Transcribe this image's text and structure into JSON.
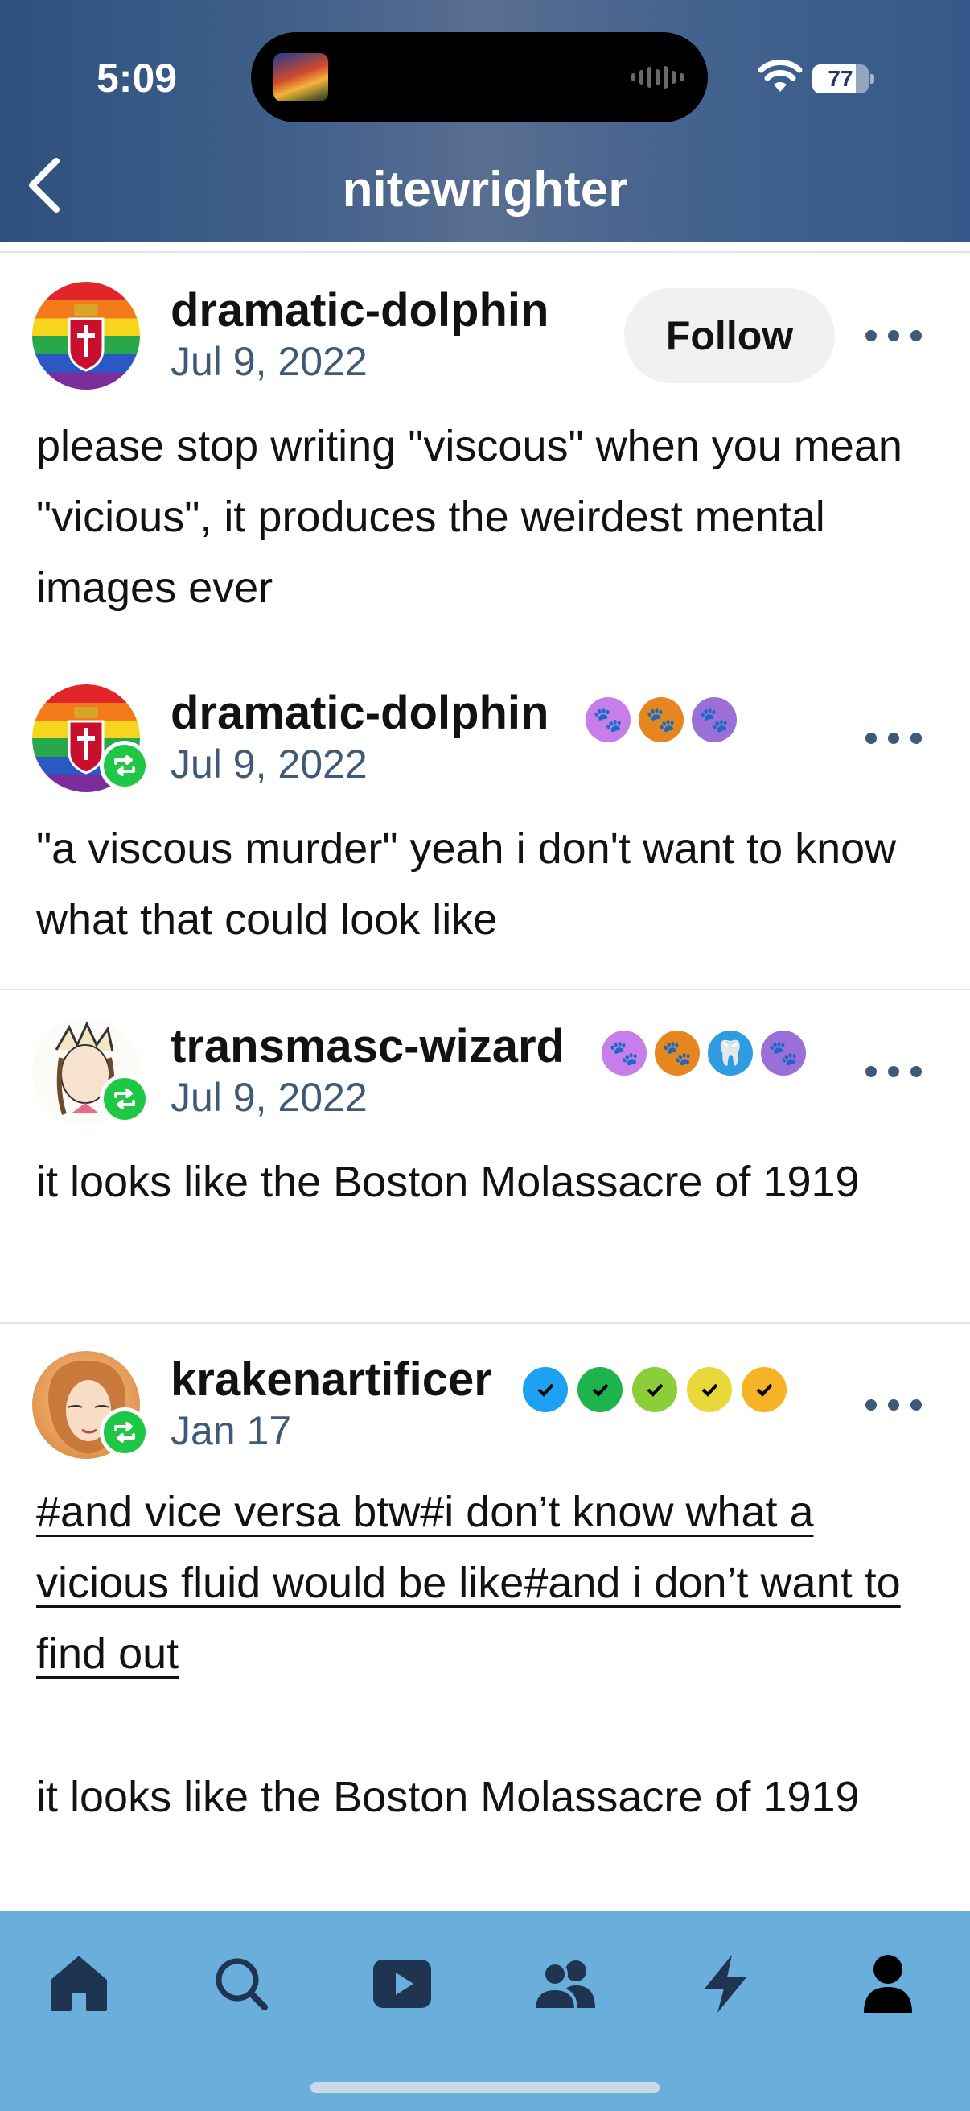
{
  "status_bar": {
    "time": "5:09",
    "battery_level": "77",
    "battery_fraction": 0.77,
    "icons": [
      "album-art-icon",
      "audio-waveform-icon",
      "wifi-icon",
      "battery-icon"
    ]
  },
  "header": {
    "title": "nitewrighter",
    "back_icon": "chevron-left-icon",
    "background_color": "#3d5c88"
  },
  "posts": [
    {
      "username": "dramatic-dolphin",
      "date": "Jul 9, 2022",
      "follow_label": "Follow",
      "text": "please stop writing \"viscous\" when you mean \"vicious\", it produces the weirdest mental images ever"
    },
    {
      "username": "dramatic-dolphin",
      "date": "Jul 9, 2022",
      "badges": [
        "pink-paw-badge",
        "orange-paw-badge",
        "black-paw-badge"
      ],
      "text": "\"a viscous murder\" yeah i don't want to know what that could look like"
    },
    {
      "username": "transmasc-wizard",
      "date": "Jul 9, 2022",
      "badges": [
        "pink-paw-badge",
        "orange-paw-badge",
        "blue-teeth-badge",
        "black-paw-badge"
      ],
      "text": "it looks like the Boston Molassacre of 1919"
    },
    {
      "username": "krakenartificer",
      "date": "Jan 17",
      "badges": [
        "blue-check-badge",
        "green-check-badge",
        "lime-check-badge",
        "yellow-check-badge",
        "orange-check-badge"
      ],
      "tags": "#and vice versa btw#i don’t know what a vicious fluid would be like#and i don’t want to find out",
      "text": "it looks like the Boston Molassacre of 1919"
    }
  ],
  "tab_bar": {
    "background_color": "#6aaedc",
    "tabs": [
      "home-icon",
      "search-icon",
      "video-icon",
      "community-icon",
      "activity-icon",
      "account-icon"
    ]
  },
  "colors": {
    "reblog_green": "#1ec845",
    "date_gray_blue": "#3f5a78",
    "follow_bg": "#eff1f3"
  }
}
